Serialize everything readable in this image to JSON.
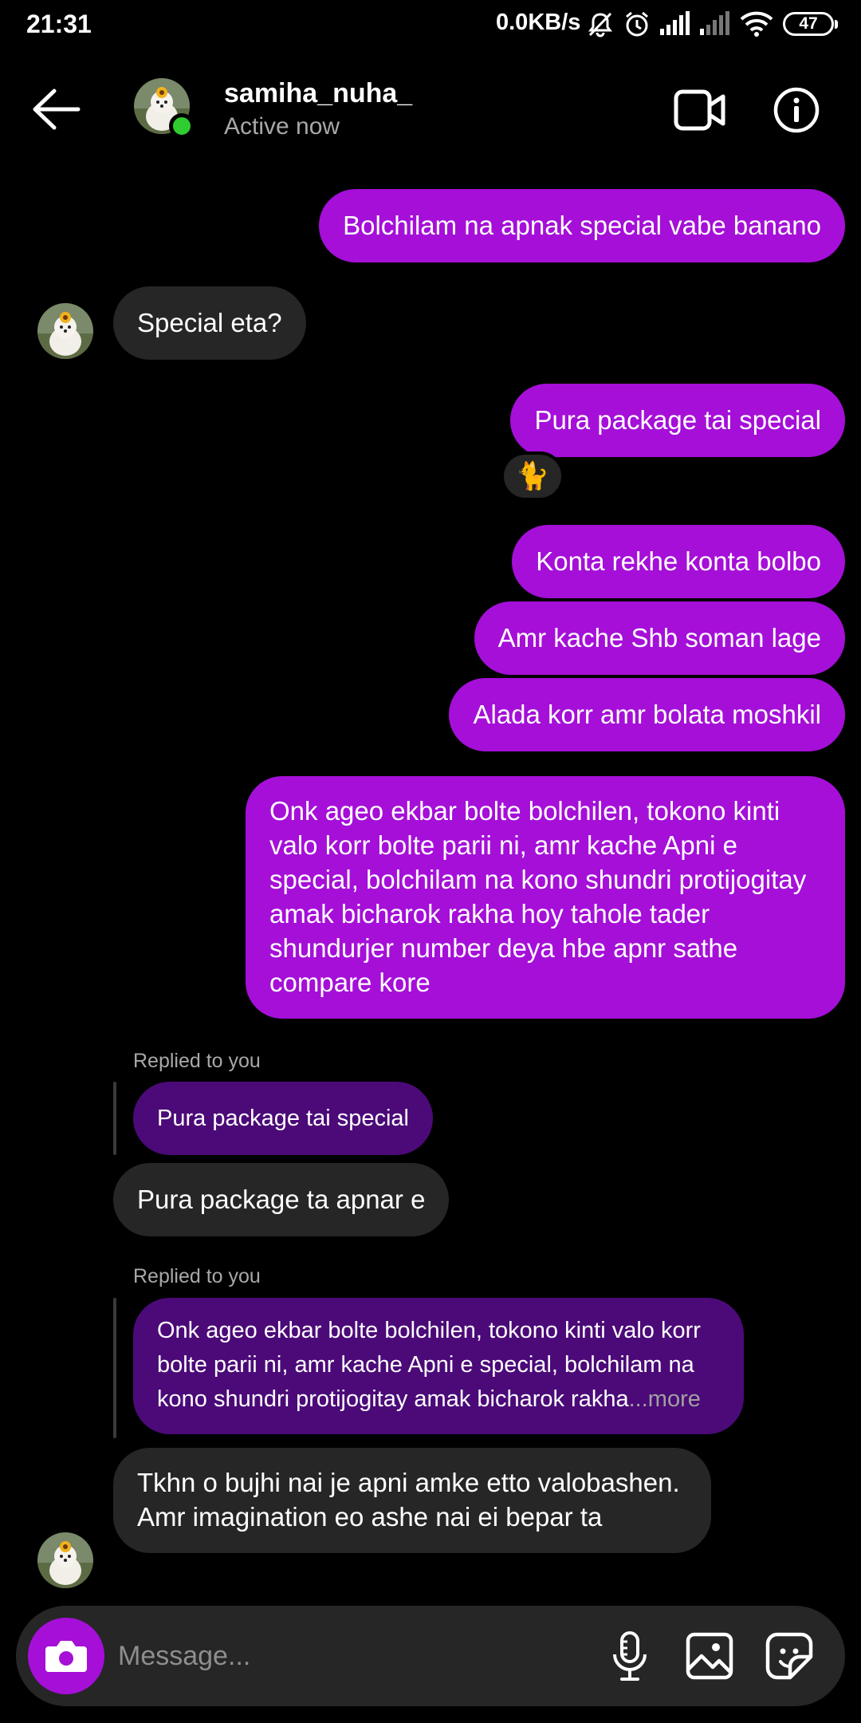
{
  "status_bar": {
    "time": "21:31",
    "net_speed": "0.0KB/s",
    "battery": "47"
  },
  "header": {
    "username": "samiha_nuha_",
    "status": "Active now"
  },
  "messages": {
    "m1": "Bolchilam na apnak special vabe banano",
    "m2": "Special eta?",
    "m3": "Pura package tai special",
    "m3_reaction": "🐈",
    "m4": "Konta rekhe konta bolbo",
    "m5": "Amr kache Shb soman lage",
    "m6": "Alada korr amr bolata moshkil",
    "m7": "Onk ageo ekbar bolte bolchilen, tokono kinti valo korr bolte parii ni, amr kache Apni e special, bolchilam na kono shundri protijogitay amak bicharok rakha hoy tahole tader shundurjer number deya hbe apnr sathe compare kore",
    "r1_label": "Replied to you",
    "r1_quote": "Pura package tai special",
    "m8": "Pura package ta apnar e",
    "r2_label": "Replied to you",
    "r2_quote": "Onk ageo ekbar bolte bolchilen, tokono kinti valo korr bolte parii ni, amr kache Apni e special, bolchilam na kono shundri protijogitay amak bicharok rakha",
    "r2_more": "...more",
    "m9": "Tkhn o bujhi nai je apni amke etto valobashen. Amr imagination eo ashe nai ei bepar ta"
  },
  "composer": {
    "placeholder": "Message..."
  },
  "colors": {
    "sent_bubble": "#a50fd8",
    "received_bubble": "#262626",
    "reply_quote": "#4b0a78",
    "online": "#2fcd2f"
  }
}
